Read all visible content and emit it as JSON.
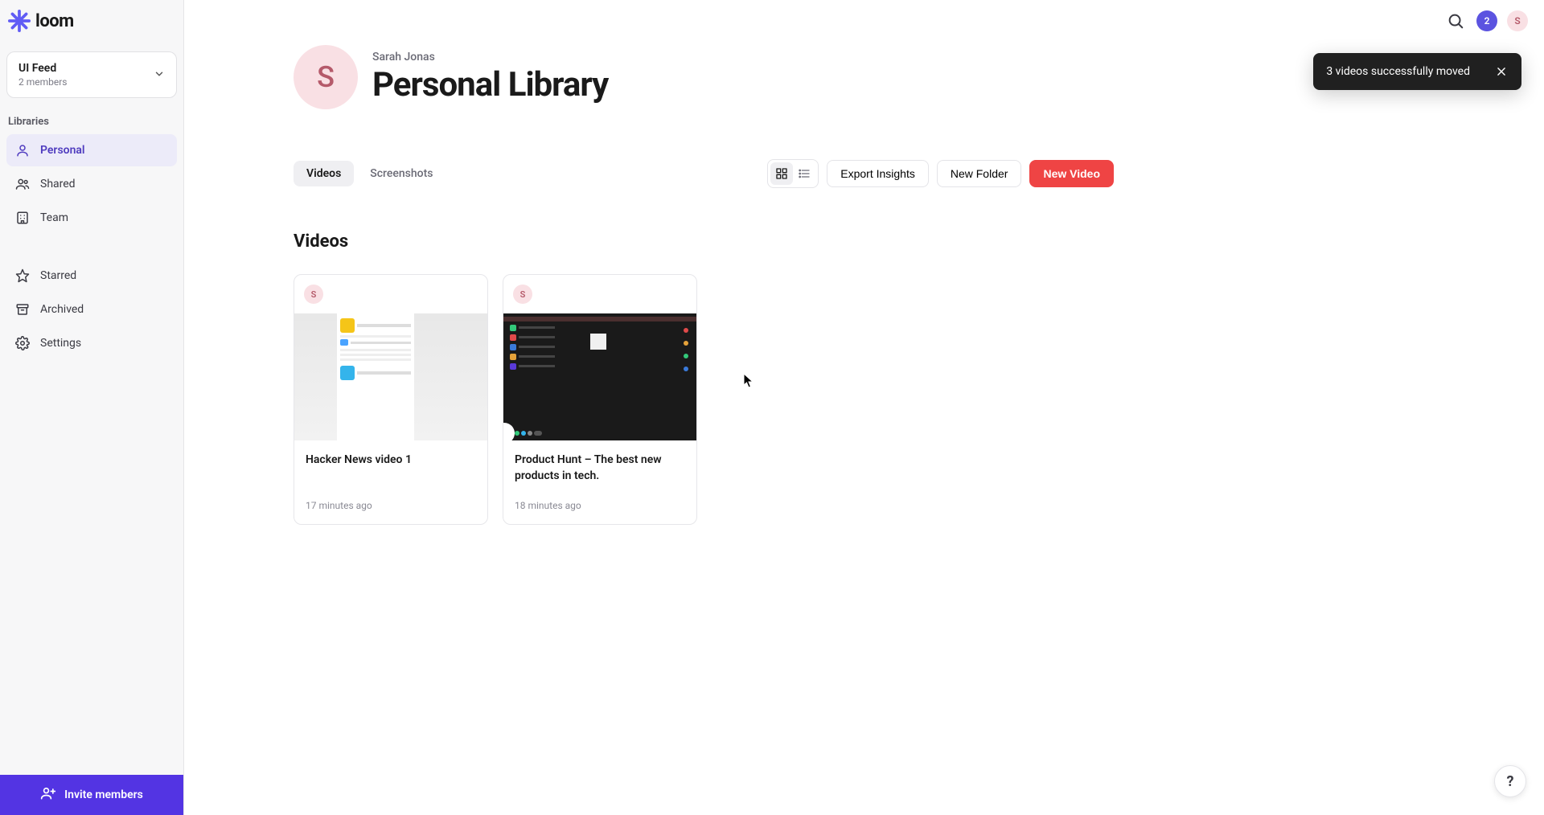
{
  "brand": {
    "name": "loom"
  },
  "workspace": {
    "name": "UI Feed",
    "members_label": "2 members"
  },
  "sidebar": {
    "section_label": "Libraries",
    "items": [
      {
        "label": "Personal"
      },
      {
        "label": "Shared"
      },
      {
        "label": "Team"
      }
    ],
    "secondary": [
      {
        "label": "Starred"
      },
      {
        "label": "Archived"
      },
      {
        "label": "Settings"
      }
    ],
    "invite_label": "Invite members"
  },
  "topbar": {
    "notif_count": "2",
    "avatar_initial": "S"
  },
  "header": {
    "avatar_initial": "S",
    "owner_name": "Sarah Jonas",
    "page_title": "Personal Library"
  },
  "toast": {
    "message": "3 videos successfully moved"
  },
  "tabs": {
    "videos": "Videos",
    "screenshots": "Screenshots"
  },
  "actions": {
    "export_insights": "Export Insights",
    "new_folder": "New Folder",
    "new_video": "New Video"
  },
  "section": {
    "heading": "Videos"
  },
  "videos": [
    {
      "avatar": "S",
      "title": "Hacker News video 1",
      "time": "17 minutes ago"
    },
    {
      "avatar": "S",
      "title": "Product Hunt – The best new products in tech.",
      "time": "18 minutes ago"
    }
  ],
  "help": {
    "label": "?"
  }
}
